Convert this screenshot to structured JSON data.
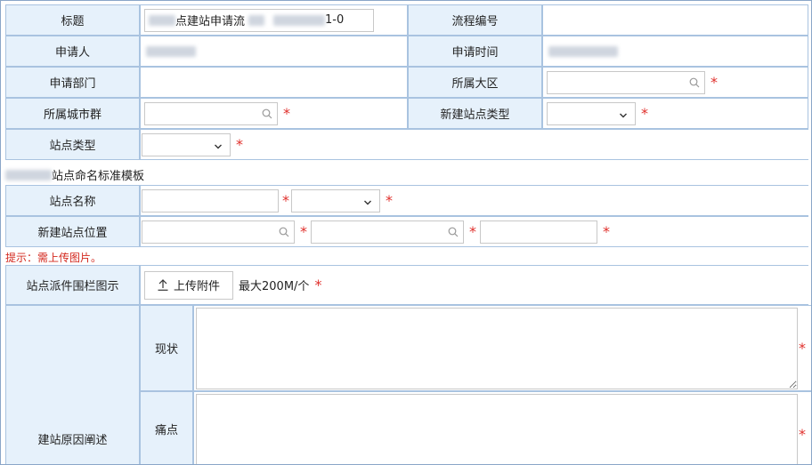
{
  "form": {
    "title_label": "标题",
    "title_value_suffix": "点建站申请流",
    "title_value_tail": "1-0",
    "process_no_label": "流程编号",
    "applicant_label": "申请人",
    "apply_time_label": "申请时间",
    "dept_label": "申请部门",
    "region_label": "所属大区",
    "city_group_label": "所属城市群",
    "new_site_type_label": "新建站点类型",
    "site_type_label": "站点类型",
    "naming_template_text": "站点命名标准模板",
    "site_name_label": "站点名称",
    "new_site_location_label": "新建站点位置",
    "hint_text": "提示：需上传图片。",
    "fence_label": "站点派件围栏图示",
    "upload_button_label": "上传附件",
    "upload_limit_text": "最大200M/个",
    "reason_label": "建站原因阐述",
    "status_label": "现状",
    "pain_label": "痛点",
    "required_mark": "*"
  },
  "colors": {
    "label_bg": "#e6f1fb",
    "border": "#a9c3e0",
    "required": "#e0302c",
    "hint": "#d3281e"
  },
  "icons": [
    "search-icon",
    "chevron-down-icon",
    "upload-icon"
  ]
}
